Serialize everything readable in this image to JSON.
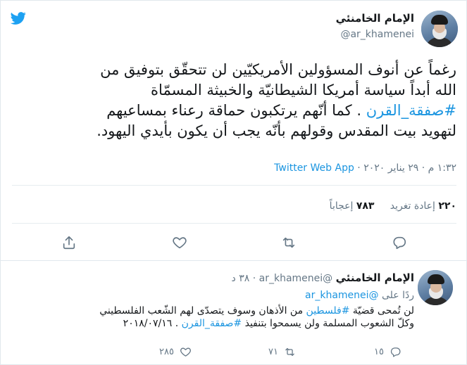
{
  "tweet": {
    "author_name": "الإمام الخامنئي",
    "author_handle": "@ar_khamenei",
    "text_lines": [
      "رغماً عن أنوف المسؤولين الأمريكيّين لن تتحقّق بتوفيق من",
      "الله أبداً سياسة أمريكا الشيطانيّة والخبيثة المسمّاة",
      ". كما أنّهم يرتكبون حماقة رعناء بمساعيهم",
      "لتهويد بيت المقدس وقولهم بأنّه يجب أن يكون بأيدي اليهود."
    ],
    "hashtag": "#صفقة_القرن",
    "time": "١:٣٢ م · ٢٩ يناير ٢٠٢٠",
    "source": "Twitter Web App",
    "retweets_count": "٢٢٠",
    "retweets_label": "إعادة تغريد",
    "likes_count": "٧٨٣",
    "likes_label": "إعجاباً"
  },
  "actions": {
    "reply_icon": "reply-icon",
    "retweet_icon": "retweet-icon",
    "like_icon": "heart-icon",
    "share_icon": "share-icon"
  },
  "reply": {
    "author_name": "الإمام الخامنئي",
    "author_handle": "@ar_khamenei",
    "age": "٣٨ د",
    "replying_label": "ردًا على",
    "replying_to": "@ar_khamenei",
    "line1_a": "لن تُمحى قضيّة",
    "line1_hashtag": "#فلسطين",
    "line1_b": "من الأذهان وسوف يتصدّى لهم الشّعب الفلسطيني",
    "line2_a": "وكلّ الشعوب المسلمة ولن يسمحوا بتنفيذ",
    "line2_hashtag": "#صفقة_القرن",
    "line2_b": ". ٢٠١٨/٠٧/١٦",
    "reply_count": "١٥",
    "retweet_count": "٧١",
    "like_count": "٢٨٥"
  },
  "colors": {
    "link": "#1b95e0",
    "secondary_text": "#657786",
    "primary_text": "#14171a",
    "twitter_blue": "#1da1f2"
  }
}
